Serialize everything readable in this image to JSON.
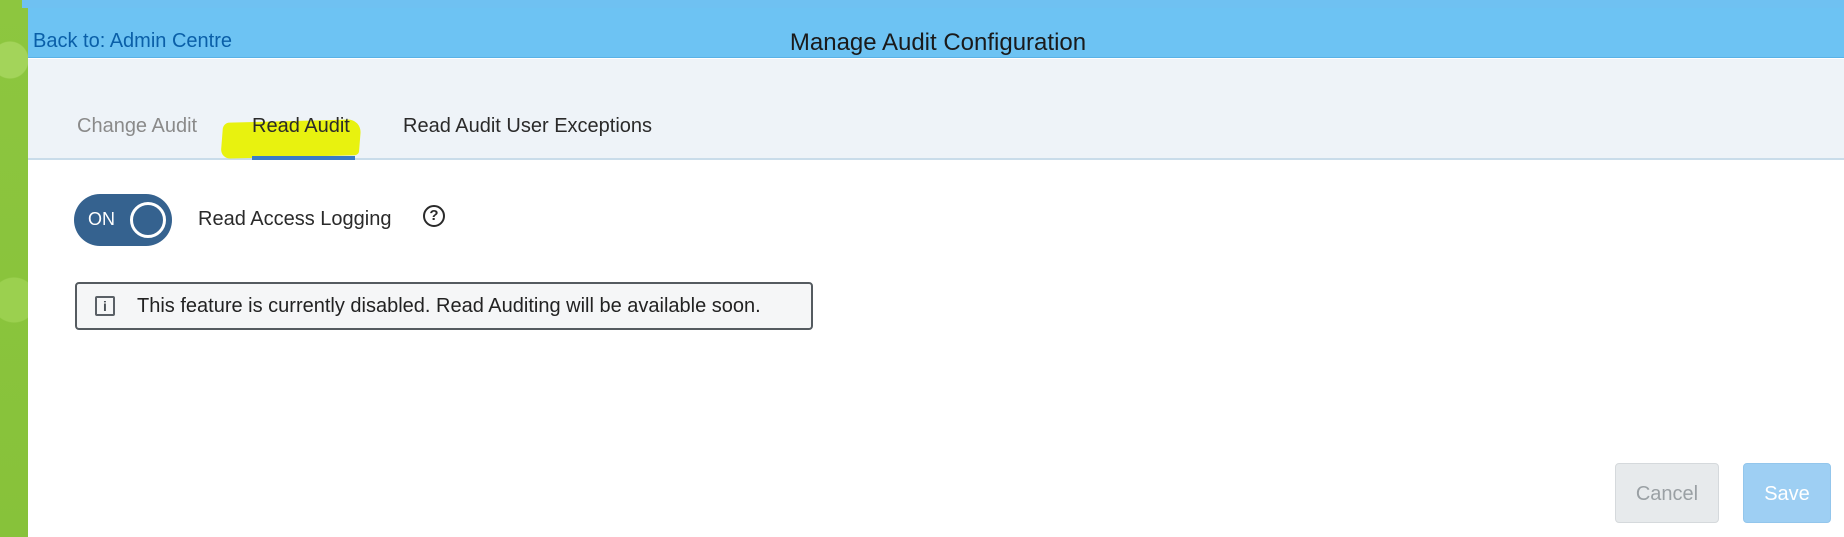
{
  "header": {
    "back_link": "Back to: Admin Centre",
    "title": "Manage Audit Configuration"
  },
  "tabs": [
    {
      "label": "Change Audit",
      "active": false
    },
    {
      "label": "Read Audit",
      "active": true
    },
    {
      "label": "Read Audit User Exceptions",
      "active": false
    }
  ],
  "settings": {
    "toggle_state": "ON",
    "label": "Read Access Logging",
    "help_icon": "?"
  },
  "notice": {
    "icon": "i",
    "text": "This feature is currently disabled. Read Auditing will be available soon."
  },
  "actions": {
    "cancel_label": "Cancel",
    "save_label": "Save"
  },
  "colors": {
    "header_bg": "#6dc3f3",
    "tabbar_bg": "#eef3f8",
    "toggle_on": "#35628f",
    "highlight": "#e8f20f",
    "save_disabled": "#9ecff3"
  }
}
